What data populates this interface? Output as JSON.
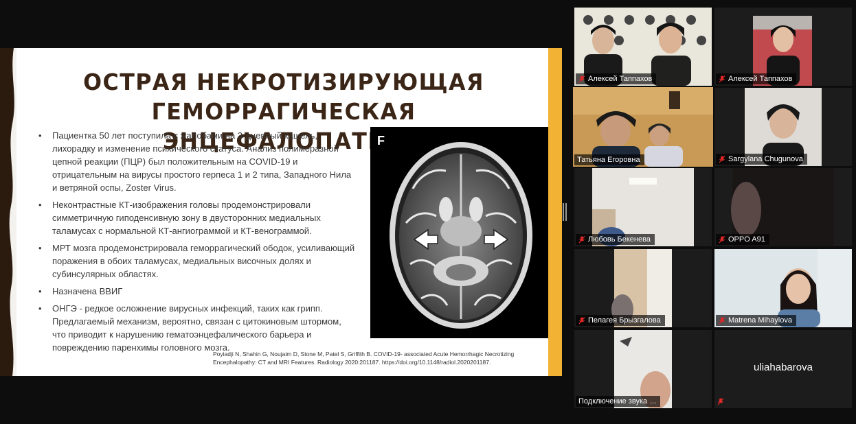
{
  "slide": {
    "title_line1": "ОСТРАЯ НЕКРОТИЗИРУЮЩАЯ",
    "title_line2": "ГЕМОРРАГИЧЕСКАЯ ЭНЦЕФАЛОПАТИЯ",
    "bullets": [
      "Пациентка 50 лет поступила с жалобами  на 3-дневный кашель, лихорадку и изменение психического статуса. Анализ полимеразной цепной реакции (ПЦР) был положительным на COVID-19 и отрицательным на вирусы простого герпеса 1 и 2 типа, Западного Нила и ветряной оспы, Zoster Virus.",
      "Неконтрастные КТ-изображения головы продемонстрировали симметричную гиподенсивную зону в двусторонних медиальных таламусах с нормальной КТ-ангиограммой и КТ-венограммой.",
      " МРТ мозга продемонстрировала геморрагический ободок, усиливающий поражения в обоих таламусах, медиальных височных долях и субинсулярных областях.",
      "Назначена ВВИГ",
      "ОНГЭ - редкое осложнение вирусных инфекций, таких как грипп. Предлагаемый механизм, вероятно, связан с цитокиновым штормом, что приводит к нарушению гематоэнцефалического барьера и повреждению паренхимы головного мозга."
    ],
    "bullet_symbol": "•",
    "image_label": "F",
    "citation": "Poyiadji N, Shahin G, Noujaim D, Stone M, Patel S, Griffith B. COVID-19- associated Acute Hemorrhagic Necrotizing Encephalopathy: CT and MRI Features. Radiology 2020:201187. https://doi.org/10.1148/radiol.2020201187.",
    "colors": {
      "title": "#3a2516",
      "accent": "#f2b233",
      "edge": "#2b1a0e"
    }
  },
  "participants": [
    {
      "name": "Алексей Таппахов",
      "muted": true,
      "video": true
    },
    {
      "name": "Алексей Таппахов",
      "muted": true,
      "video": true
    },
    {
      "name": "Татьяна Егоровна",
      "muted": false,
      "video": true,
      "active_speaker": true
    },
    {
      "name": "Sargylana Chugunova",
      "muted": true,
      "video": true
    },
    {
      "name": "Любовь Бекенева",
      "muted": true,
      "video": true
    },
    {
      "name": "OPPO A91",
      "muted": true,
      "video": true
    },
    {
      "name": "Пелагея Брызгалова",
      "muted": true,
      "video": true
    },
    {
      "name": "Matrena Mihaylova",
      "muted": true,
      "video": true
    },
    {
      "name": "Подключение звука",
      "status_suffix": "...",
      "video": true
    },
    {
      "name": "uliahabarova",
      "muted": true,
      "video": false
    }
  ],
  "icons": {
    "muted": "mic-off-icon",
    "connecting": "loading-dots"
  }
}
